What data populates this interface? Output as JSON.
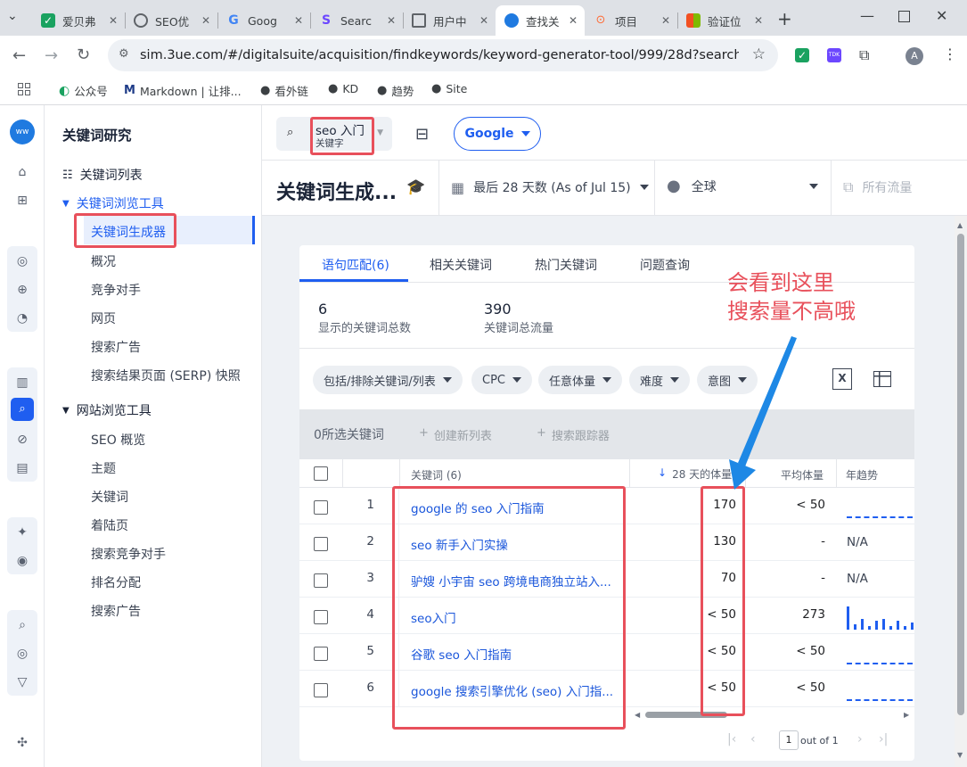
{
  "browser": {
    "tabs": [
      {
        "label": "爱贝弗",
        "color": "#1aa260"
      },
      {
        "label": "SEO优",
        "color": "#5f6368"
      },
      {
        "label": "Goog",
        "color": "#4285f4"
      },
      {
        "label": "Searc",
        "color": "#6c47ff"
      },
      {
        "label": "用户中",
        "color": "#5f6368"
      },
      {
        "label": "查找关",
        "color": "#1f7ae0"
      },
      {
        "label": "项目",
        "color": "#ff6b35"
      },
      {
        "label": "验证位",
        "color": "#f25022"
      }
    ],
    "url": "sim.3ue.com/#/digitalsuite/acquisition/findkeywords/keyword-generator-tool/999/28d?searchEng...",
    "bookmarks": [
      "公众号",
      "Markdown | 让排...",
      "看外链",
      "KD",
      "趋势",
      "Site"
    ],
    "profile_initial": "A"
  },
  "nav": {
    "title": "关键词研究",
    "items": [
      {
        "label": "关键词列表",
        "type": "section"
      },
      {
        "label": "关键词浏览工具",
        "type": "section-expanded"
      },
      {
        "label": "关键词生成器",
        "type": "item-active"
      },
      {
        "label": "概况",
        "type": "item"
      },
      {
        "label": "竞争对手",
        "type": "item"
      },
      {
        "label": "网页",
        "type": "item"
      },
      {
        "label": "搜索广告",
        "type": "item"
      },
      {
        "label": "搜索结果页面 (SERP) 快照",
        "type": "item"
      },
      {
        "label": "网站浏览工具",
        "type": "section"
      },
      {
        "label": "SEO 概览",
        "type": "item"
      },
      {
        "label": "主题",
        "type": "item"
      },
      {
        "label": "关键词",
        "type": "item"
      },
      {
        "label": "着陆页",
        "type": "item"
      },
      {
        "label": "搜索竞争对手",
        "type": "item"
      },
      {
        "label": "排名分配",
        "type": "item"
      },
      {
        "label": "搜索广告",
        "type": "item"
      }
    ]
  },
  "search": {
    "value": "seo 入门",
    "type_label": "关键字",
    "engine": "Google"
  },
  "header": {
    "title": "关键词生成...",
    "date_range": "最后 28 天数 (As of Jul 15)",
    "region": "全球",
    "traffic": "所有流量"
  },
  "card": {
    "tabs": [
      "语句匹配(6)",
      "相关关键词",
      "热门关键词",
      "问题查询"
    ],
    "stats": [
      {
        "value": "6",
        "label": "显示的关键词总数"
      },
      {
        "value": "390",
        "label": "关键词总流量"
      }
    ],
    "filters": [
      "包括/排除关键词/列表",
      "CPC",
      "任意体量",
      "难度",
      "意图"
    ],
    "selection": {
      "count_label": "0所选关键词",
      "create_list": "创建新列表",
      "search_tracker": "搜索跟踪器"
    },
    "columns": {
      "keyword": "关键词 (6)",
      "volume": "28 天的体量",
      "avg": "平均体量",
      "trend": "年趋势"
    },
    "rows": [
      {
        "idx": "1",
        "keyword": "google 的 seo 入门指南",
        "volume": "170",
        "avg": "< 50",
        "trend": "dashed"
      },
      {
        "idx": "2",
        "keyword": "seo 新手入门实操",
        "volume": "130",
        "avg": "-",
        "trend": "N/A"
      },
      {
        "idx": "3",
        "keyword": "驴嫂 小宇宙 seo 跨境电商独立站入...",
        "volume": "70",
        "avg": "-",
        "trend": "N/A"
      },
      {
        "idx": "4",
        "keyword": "seo入门",
        "volume": "< 50",
        "avg": "273",
        "trend": "bars"
      },
      {
        "idx": "5",
        "keyword": "谷歌 seo 入门指南",
        "volume": "< 50",
        "avg": "< 50",
        "trend": "dashed"
      },
      {
        "idx": "6",
        "keyword": "google 搜索引擎优化 (seo) 入门指...",
        "volume": "< 50",
        "avg": "< 50",
        "trend": "dashed"
      }
    ],
    "pagination": {
      "page": "1",
      "of": "out of 1"
    }
  },
  "annotation": {
    "line1": "会看到这里",
    "line2": "搜索量不高哦",
    "color": "#e8505b",
    "arrow_color": "#1e88e5"
  }
}
